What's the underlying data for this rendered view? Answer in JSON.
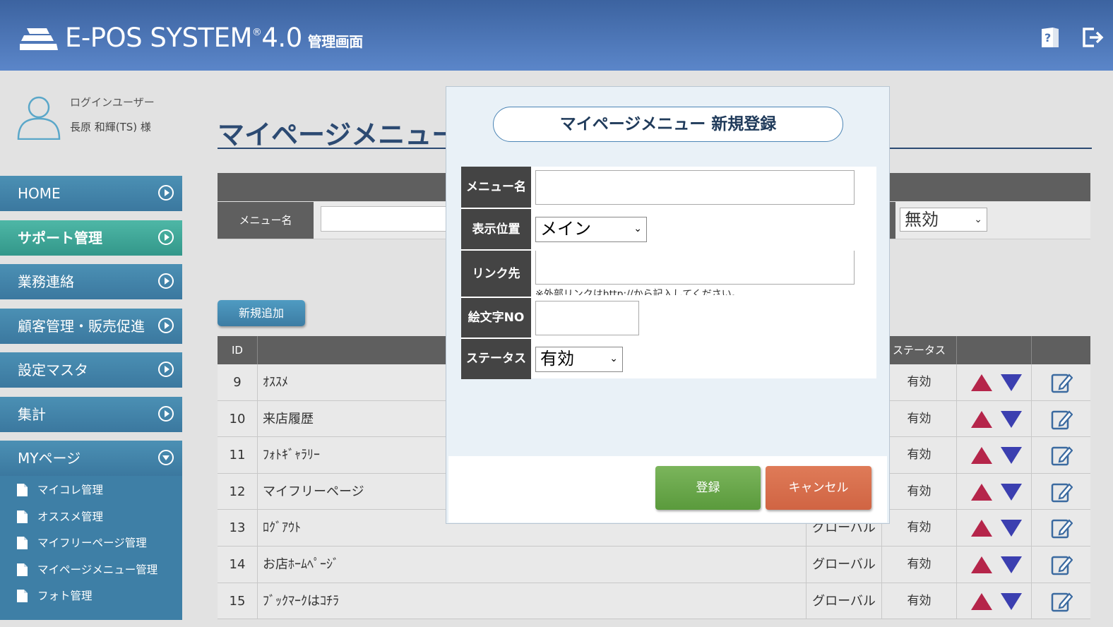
{
  "header": {
    "logo_main": "E-POS SYSTEM",
    "logo_reg": "®",
    "logo_version": "4.0",
    "logo_sub": "管理画面",
    "icons": [
      "help-book-icon",
      "logout-icon"
    ]
  },
  "user": {
    "label": "ログインユーザー",
    "name": "長原 和輝(TS) 様"
  },
  "sidebar": {
    "items": [
      {
        "label": "HOME"
      },
      {
        "label": "サポート管理"
      },
      {
        "label": "業務連絡"
      },
      {
        "label": "顧客管理・販売促進"
      },
      {
        "label": "設定マスタ"
      },
      {
        "label": "集計"
      },
      {
        "label": "MYページ"
      }
    ],
    "subitems": [
      {
        "label": "マイコレ管理"
      },
      {
        "label": "オススメ管理"
      },
      {
        "label": "マイフリーページ管理"
      },
      {
        "label": "マイページメニュー管理"
      },
      {
        "label": "フォト管理"
      }
    ]
  },
  "main": {
    "page_title": "マイページメニュー",
    "search": {
      "menu_name_label": "メニュー名",
      "menu_name_value": "",
      "status_value": "無効"
    },
    "add_button": "新規追加",
    "table": {
      "headers": {
        "id": "ID",
        "status": "ステータス"
      },
      "rows": [
        {
          "id": "9",
          "name": "ｵｽｽﾒ",
          "position": "",
          "status": "有効"
        },
        {
          "id": "10",
          "name": "来店履歴",
          "position": "",
          "status": "有効"
        },
        {
          "id": "11",
          "name": "ﾌｫﾄｷﾞｬﾗﾘｰ",
          "position": "",
          "status": "有効"
        },
        {
          "id": "12",
          "name": "マイフリーページ",
          "position": "",
          "status": "有効"
        },
        {
          "id": "13",
          "name": "ﾛｸﾞｱｳﾄ",
          "position": "グローバル",
          "status": "有効"
        },
        {
          "id": "14",
          "name": "お店ﾎｰﾑﾍﾟｰｼﾞ",
          "position": "グローバル",
          "status": "有効"
        },
        {
          "id": "15",
          "name": "ﾌﾞｯｸﾏｰｸはｺﾁﾗ",
          "position": "グローバル",
          "status": "有効"
        }
      ]
    }
  },
  "modal": {
    "title": "マイページメニュー 新規登録",
    "fields": {
      "menu_name_label": "メニュー名",
      "menu_name_value": "",
      "position_label": "表示位置",
      "position_value": "メイン",
      "link_label": "リンク先",
      "link_value": "",
      "link_note": "※外部リンクはhttp://から記入してください。",
      "emoji_label": "絵文字NO",
      "emoji_value": "",
      "status_label": "ステータス",
      "status_value": "有効"
    },
    "register_button": "登録",
    "cancel_button": "キャンセル"
  },
  "colors": {
    "header_bg": "#4a74b4",
    "nav_bg": "#3b789f",
    "nav_active": "#33978a",
    "up_arrow": "#b5254a",
    "down_arrow": "#3b3fb0",
    "register": "#5a9a3c",
    "cancel": "#d06443"
  }
}
